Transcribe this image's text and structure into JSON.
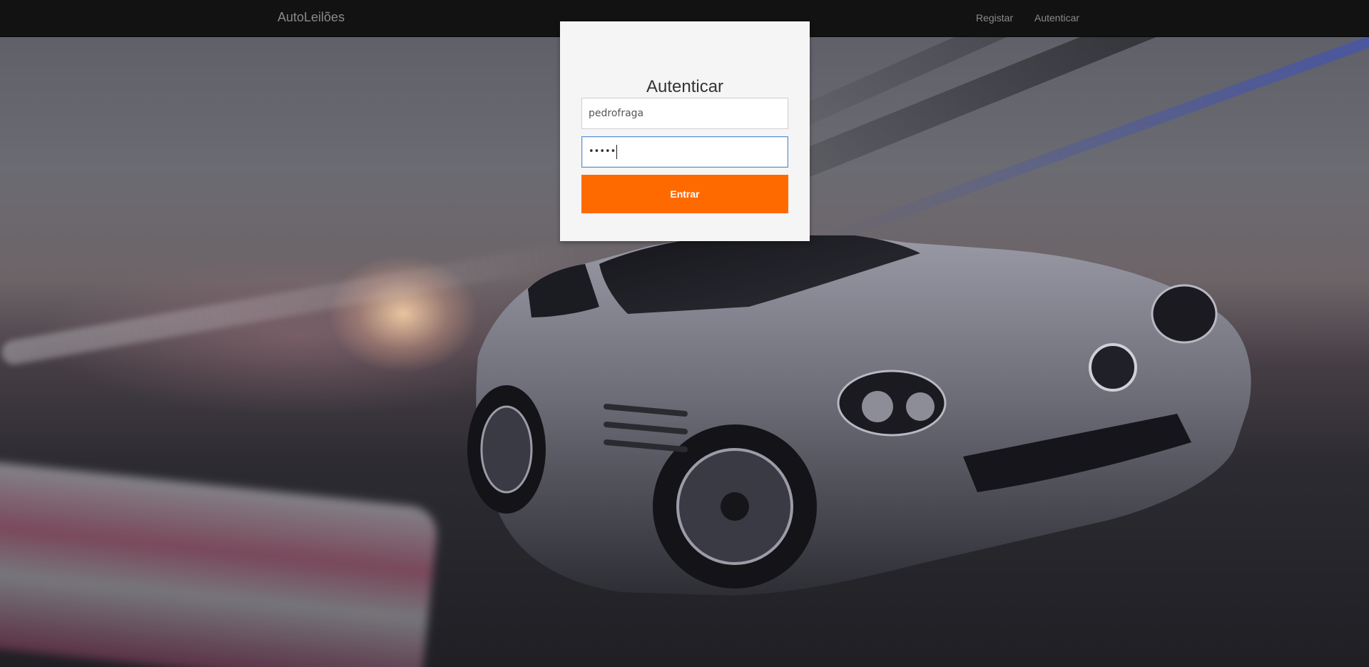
{
  "navbar": {
    "brand": "AutoLeilões",
    "links": [
      {
        "label": "Registar"
      },
      {
        "label": "Autenticar"
      }
    ]
  },
  "login": {
    "title": "Autenticar",
    "username_value": "pedrofraga",
    "password_masked": "•••••",
    "submit_label": "Entrar"
  },
  "colors": {
    "navbar_bg": "#121212",
    "card_bg": "#f5f5f5",
    "accent": "#ff6a00",
    "focus_border": "#5b8fd6"
  },
  "hero": {
    "subject": "silver sports car on race track at sunset"
  }
}
